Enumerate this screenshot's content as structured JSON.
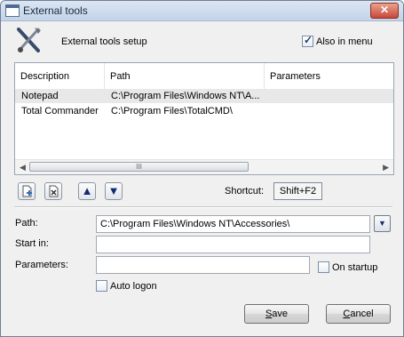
{
  "window": {
    "title": "External tools",
    "close_glyph": "✕"
  },
  "header": {
    "icon": "tools-icon",
    "title": "External tools setup"
  },
  "also_in_menu": {
    "label": "Also in menu",
    "checked": true
  },
  "list": {
    "columns": [
      "Description",
      "Path",
      "Parameters"
    ],
    "rows": [
      {
        "description": "Notepad",
        "path": "C:\\Program Files\\Windows NT\\A...",
        "parameters": ""
      },
      {
        "description": "Total Commander",
        "path": "C:\\Program Files\\TotalCMD\\",
        "parameters": ""
      }
    ],
    "scroll_left_glyph": "◀",
    "scroll_right_glyph": "▶",
    "scroll_thumb_grip": "III"
  },
  "toolbar": {
    "add_icon": "new-document-icon",
    "delete_icon": "delete-document-icon",
    "up_glyph": "▲",
    "down_glyph": "▼"
  },
  "shortcut": {
    "label": "Shortcut:",
    "value": "Shift+F2"
  },
  "form": {
    "path_label": "Path:",
    "path_value": "C:\\Program Files\\Windows NT\\Accessories\\",
    "dropdown_glyph": "▼",
    "start_in_label": "Start in:",
    "start_in_value": "",
    "parameters_label": "Parameters:",
    "parameters_value": "",
    "on_startup_label": "On startup",
    "on_startup_checked": false,
    "auto_logon_label": "Auto logon",
    "auto_logon_checked": false
  },
  "buttons": {
    "save_first": "S",
    "save_rest": "ave",
    "cancel_first": "C",
    "cancel_rest": "ancel"
  }
}
